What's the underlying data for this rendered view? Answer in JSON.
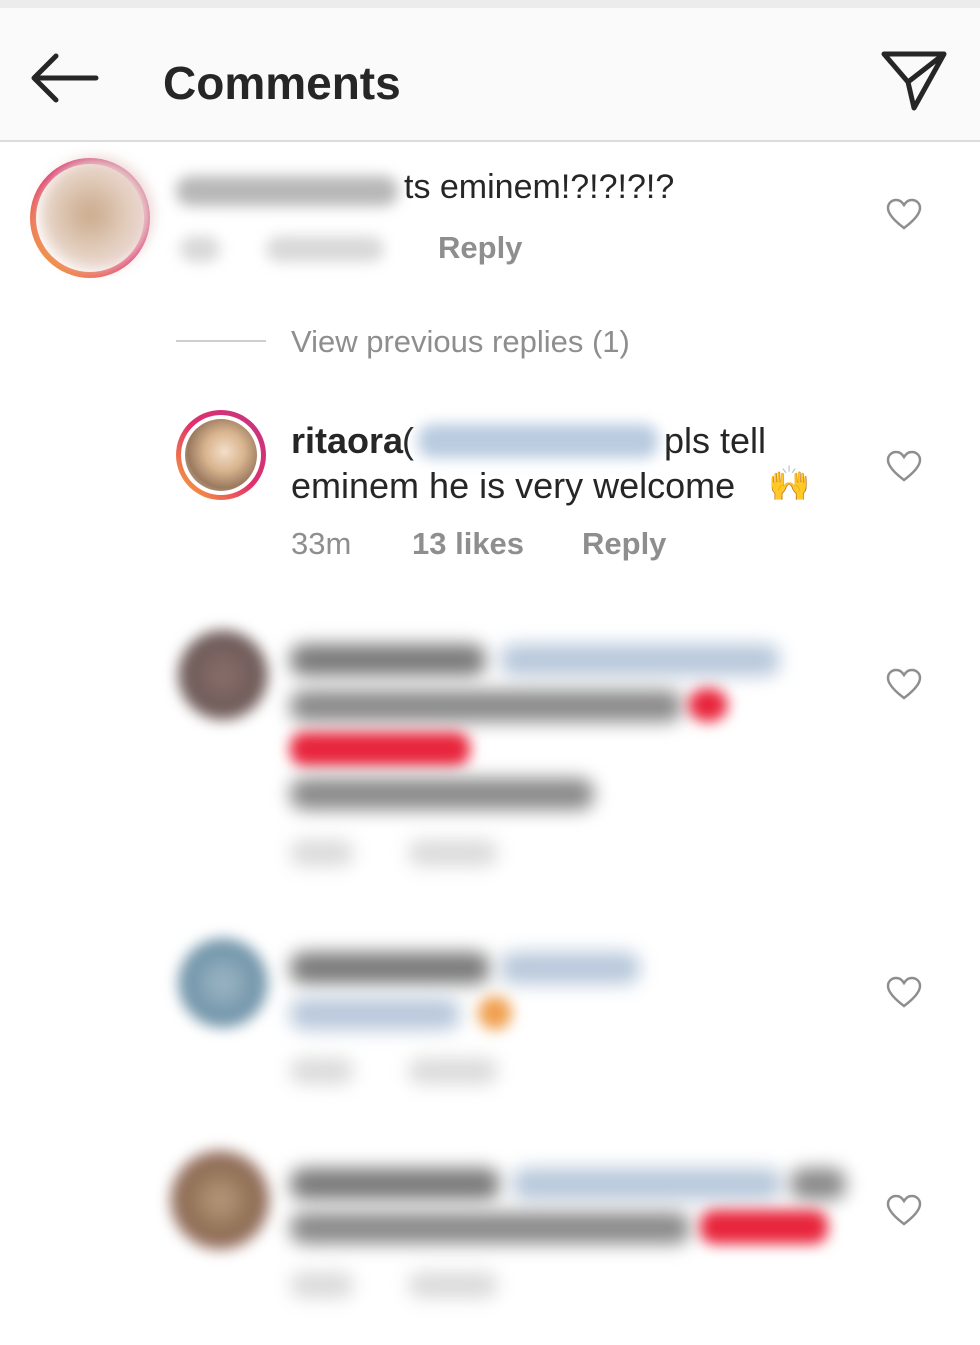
{
  "header": {
    "title": "Comments",
    "back_icon": "arrow-left-icon",
    "send_icon": "paper-plane-icon"
  },
  "comment1": {
    "text_tail": "ts eminem!?!?!?!?",
    "reply": "Reply"
  },
  "view_previous": "View previous replies (1)",
  "reply_ritaora": {
    "username": "ritaora",
    "paren": "(",
    "text_after_mention": "pls tell",
    "line2": "eminem he is very welcome",
    "emoji": "🙌",
    "time": "33m",
    "likes": "13 likes",
    "reply": "Reply"
  },
  "colors": {
    "text": "#262626",
    "secondary": "#8e8e8e",
    "mention_blur": "#b9cbe0",
    "heart_red": "#e8253c"
  }
}
